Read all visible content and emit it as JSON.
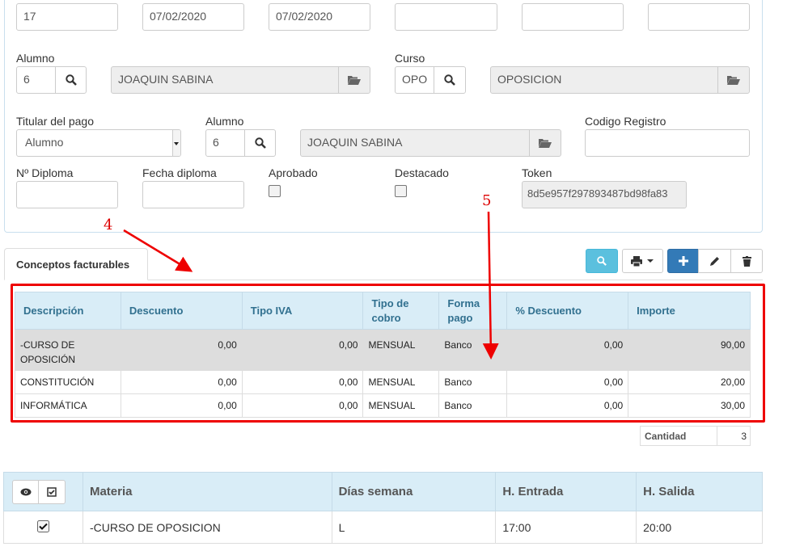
{
  "top_row": {
    "field1": "17",
    "date1": "07/02/2020",
    "date2": "07/02/2020",
    "field4": "",
    "field5": "",
    "field6": ""
  },
  "row1": {
    "alumno_label": "Alumno",
    "alumno_id": "6",
    "alumno_name": "JOAQUIN SABINA",
    "curso_label": "Curso",
    "curso_id": "OPO",
    "curso_name": "OPOSICION"
  },
  "row2": {
    "titular_label": "Titular del pago",
    "titular_value": "Alumno",
    "alumno_label": "Alumno",
    "alumno_id": "6",
    "alumno_name": "JOAQUIN SABINA",
    "codigo_label": "Codigo Registro",
    "codigo_value": ""
  },
  "row3": {
    "diploma_label": "Nº Diploma",
    "diploma_value": "",
    "fecha_label": "Fecha diploma",
    "fecha_value": "",
    "aprobado_label": "Aprobado",
    "destacado_label": "Destacado",
    "token_label": "Token",
    "token_value": "8d5e957f297893487bd98fa83"
  },
  "tab": {
    "label": "Conceptos facturables"
  },
  "conceptos": {
    "headers": [
      "Descripción",
      "Descuento",
      "Tipo IVA",
      "Tipo de cobro",
      "Forma pago",
      "% Descuento",
      "Importe"
    ],
    "rows": [
      [
        "-CURSO DE OPOSICIÓN",
        "0,00",
        "0,00",
        "MENSUAL",
        "Banco",
        "0,00",
        "90,00"
      ],
      [
        "CONSTITUCIÓN",
        "0,00",
        "0,00",
        "MENSUAL",
        "Banco",
        "0,00",
        "20,00"
      ],
      [
        "INFORMÁTICA",
        "0,00",
        "0,00",
        "MENSUAL",
        "Banco",
        "0,00",
        "30,00"
      ]
    ],
    "cantidad_label": "Cantidad",
    "cantidad_value": "3"
  },
  "materias": {
    "headers": [
      "Materia",
      "Días semana",
      "H. Entrada",
      "H. Salida"
    ],
    "rows": [
      [
        "-CURSO DE OPOSICION",
        "L",
        "17:00",
        "20:00"
      ]
    ]
  },
  "annotations": {
    "a4": "4",
    "a5": "5"
  },
  "colors": {
    "accent": "#337ab7",
    "info": "#5bc0de",
    "header_bg": "#d9edf7",
    "annotation": "#e00000"
  }
}
